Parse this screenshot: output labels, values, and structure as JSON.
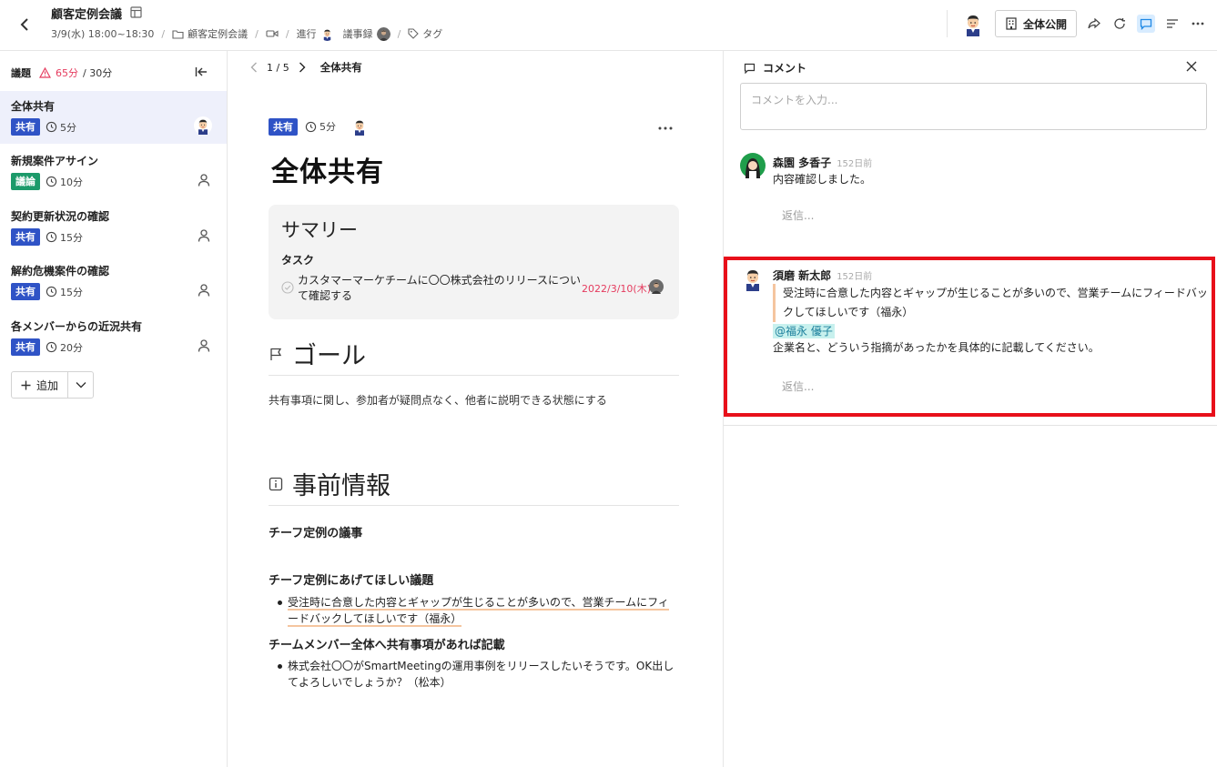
{
  "header": {
    "title": "顧客定例会議",
    "datetime": "3/9(水) 18:00~18:30",
    "folder": "顧客定例会議",
    "facilitator_label": "進行",
    "minutes_label": "議事録",
    "tag_label": "タグ",
    "public_label": "全体公開"
  },
  "sidebar": {
    "label": "議題",
    "over_time": "65分",
    "total_time": "/ 30分",
    "items": [
      {
        "title": "全体共有",
        "badge": "共有",
        "duration": "5分"
      },
      {
        "title": "新規案件アサイン",
        "badge": "議論",
        "duration": "10分"
      },
      {
        "title": "契約更新状況の確認",
        "badge": "共有",
        "duration": "15分"
      },
      {
        "title": "解約危機案件の確認",
        "badge": "共有",
        "duration": "15分"
      },
      {
        "title": "各メンバーからの近況共有",
        "badge": "共有",
        "duration": "20分"
      }
    ],
    "add_label": "追加"
  },
  "main": {
    "pager": "1 / 5",
    "crumb": "全体共有",
    "badge": "共有",
    "duration": "5分",
    "heading": "全体共有",
    "summary_title": "サマリー",
    "task_label": "タスク",
    "task_text": "カスタマーマーケチームに〇〇株式会社のリリースについて確認する",
    "task_date": "2022/3/10(木)",
    "goal_title": "ゴール",
    "goal_text": "共有事項に関し、参加者が疑問点なく、他者に説明できる状態にする",
    "info_title": "事前情報",
    "sub1": "チーフ定例の議事",
    "sub2": "チーフ定例にあげてほしい議題",
    "bullet1": "受注時に合意した内容とギャップが生じることが多いので、営業チームにフィードバックしてほしいです（福永）",
    "sub3": "チームメンバー全体へ共有事項があれば記載",
    "bullet2": "株式会社〇〇がSmartMeetingの運用事例をリリースしたいそうです。OK出してよろしいでしょうか？（松本）"
  },
  "comments": {
    "title": "コメント",
    "input_placeholder": "コメントを入力...",
    "items": [
      {
        "author": "森園 多香子",
        "time": "152日前",
        "body": "内容確認しました。",
        "reply": "返信..."
      },
      {
        "author": "須磨 新太郎",
        "time": "152日前",
        "quote": "受注時に合意した内容とギャップが生じることが多いので、営業チームにフィードバックしてほしいです（福永）",
        "mention": "@福永 優子",
        "body": "企業名と、どういう指摘があったかを具体的に記載してください。",
        "reply": "返信..."
      }
    ]
  },
  "colors": {
    "share_badge": "#2f53c6",
    "discuss_badge": "#1c9a6a",
    "warning": "#e53b5e",
    "highlight_border": "#e8101a",
    "quote_underline": "#f5c59f",
    "mention_bg": "#c8f1ee"
  }
}
